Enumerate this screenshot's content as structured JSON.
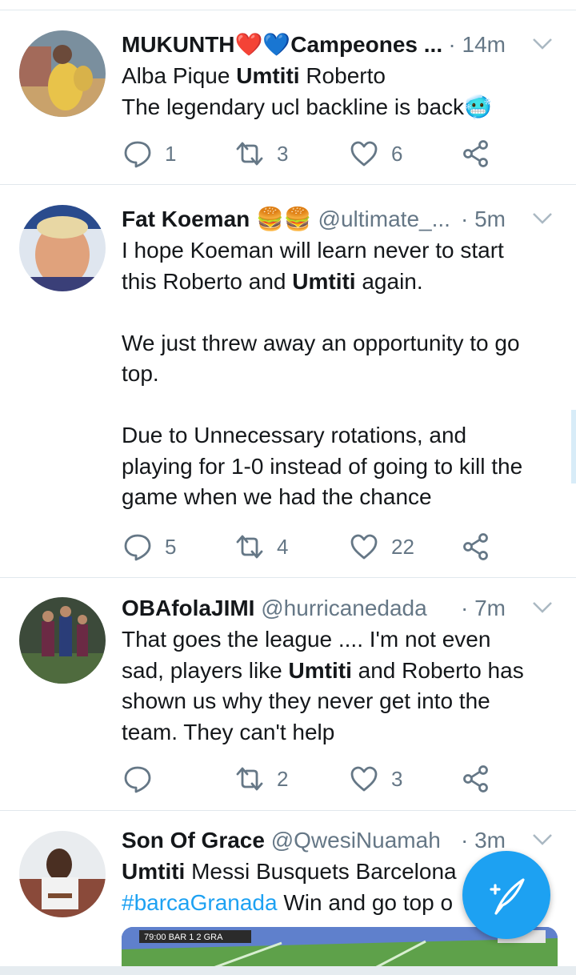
{
  "tweets": [
    {
      "name": "MUKUNTH❤️💙Campeones ...",
      "handle": "",
      "time": "· 14m",
      "lines": [
        "Alba Pique |Umtiti| Roberto",
        "The legendary ucl backline is back🥶"
      ],
      "reply_count": "1",
      "retweet_count": "3",
      "like_count": "6"
    },
    {
      "name": "Fat Koeman 🍔🍔",
      "handle": "@ultimate_...",
      "time": "· 5m",
      "lines": [
        "I hope Koeman will learn never to start",
        "this Roberto and |Umtiti| again.",
        "",
        "We just threw away an opportunity to go",
        "top.",
        "",
        "Due to Unnecessary rotations, and",
        "playing for 1-0 instead of going to kill the",
        "game when we had the chance"
      ],
      "reply_count": "5",
      "retweet_count": "4",
      "like_count": "22"
    },
    {
      "name": "OBAfolaJIMI",
      "handle": "@hurricanedada",
      "time": "· 7m",
      "lines": [
        "That goes the league .... I'm not even",
        "sad, players like |Umtiti| and Roberto has",
        "shown us why they never get into the",
        "team. They can't help"
      ],
      "reply_count": "",
      "retweet_count": "2",
      "like_count": "3"
    },
    {
      "name": "Son Of Grace",
      "handle": "@QwesiNuamah",
      "time": "· 3m",
      "lines": [
        "|Umtiti| Messi Busquets Barcelona",
        "#barcaGranada Win and go top o"
      ],
      "reply_count": "",
      "retweet_count": "",
      "like_count": ""
    }
  ],
  "media_overlay": "79:00 BAR 1 2 GRA",
  "icons": {
    "reply": "reply-icon",
    "retweet": "retweet-icon",
    "like": "like-icon",
    "share": "share-icon",
    "menu": "chevron-down-icon",
    "compose": "compose-tweet-icon"
  },
  "colors": {
    "accent": "#1da1f2",
    "secondary_text": "#657786",
    "divider": "#e1e8ed",
    "heart": "#e0245e",
    "blue_heart": "#5dadec"
  }
}
